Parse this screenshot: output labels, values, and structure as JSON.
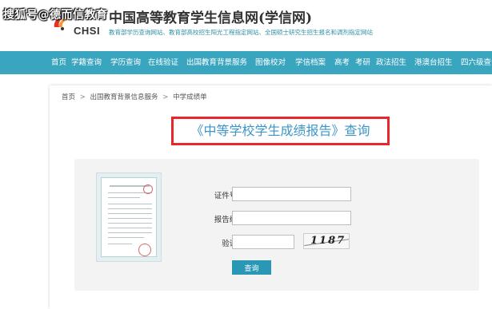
{
  "watermark": "搜狐号@德而信教育",
  "header": {
    "site_title": "中国高等教育学生信息网(学信网)",
    "logo_text": "CHSI",
    "tagline": "教育部学历查询网站、教育部高校招生阳光工程指定网站、全国硕士研究生招生报名和调剂指定网站"
  },
  "nav": {
    "items": [
      {
        "label": "首页"
      },
      {
        "label": "学籍查询"
      },
      {
        "label": "学历查询"
      },
      {
        "label": "在线验证"
      },
      {
        "label": "出国教育背景服务"
      },
      {
        "label": "图像校对"
      },
      {
        "label": "学信档案"
      },
      {
        "label": "高考"
      },
      {
        "label": "考研"
      },
      {
        "label": "政法招生"
      },
      {
        "label": "港澳台招生"
      },
      {
        "label": "四六级查询"
      }
    ]
  },
  "breadcrumb": {
    "items": [
      {
        "label": "首页"
      },
      {
        "label": "出国教育背景信息服务"
      },
      {
        "label": "中学成绩单"
      }
    ],
    "separator": ">"
  },
  "page_title": "《中等学校学生成绩报告》查询",
  "form": {
    "cert_label": "证件号码:",
    "cert_value": "",
    "report_label": "报告编号:",
    "report_value": "",
    "captcha_label": "验证码:",
    "captcha_value": "",
    "captcha_image_text": "1187",
    "submit_label": "查询"
  },
  "colors": {
    "nav_bg": "#3aa5bf",
    "title_text": "#3c95c6",
    "highlight_border": "#e8262b",
    "button_bg": "#2a97b4"
  }
}
